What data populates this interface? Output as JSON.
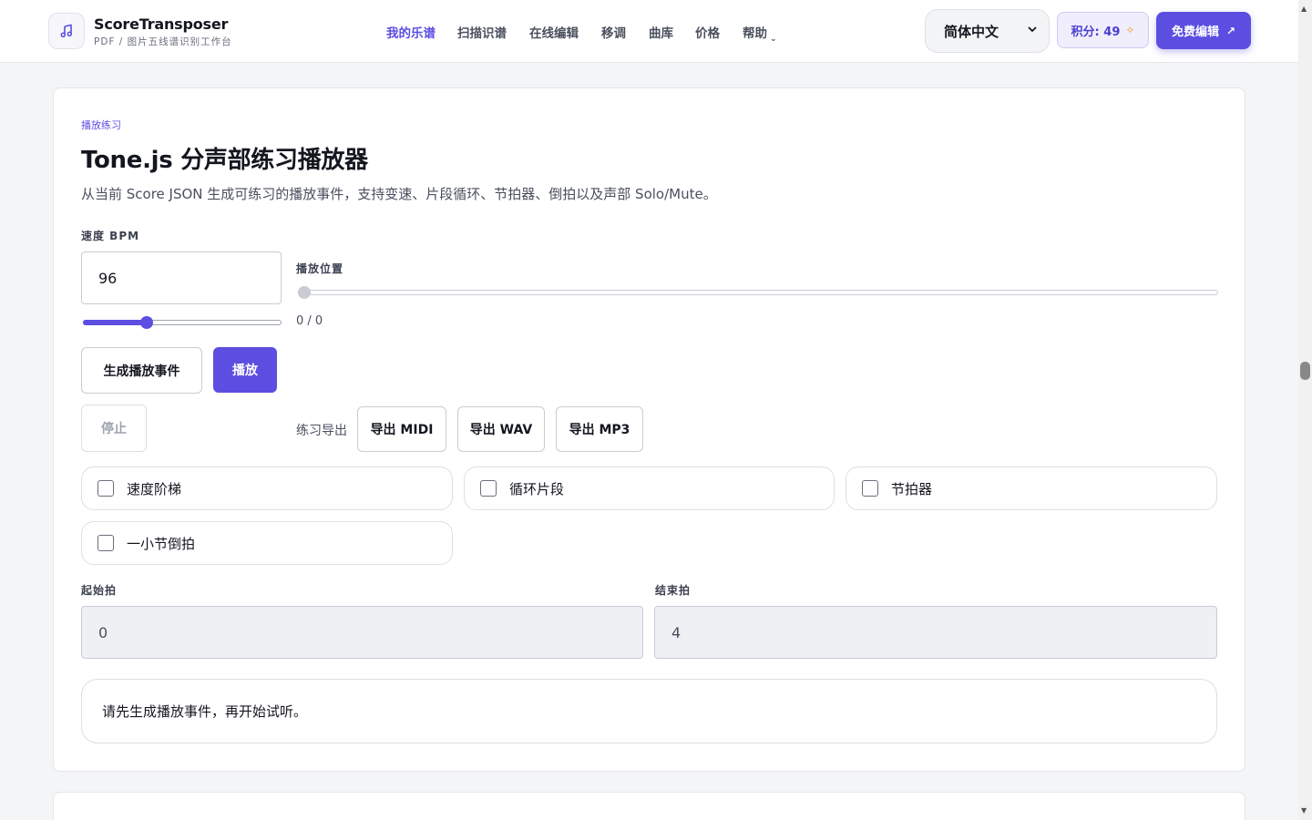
{
  "brand": {
    "name": "ScoreTransposer",
    "subtitle": "PDF / 图片五线谱识别工作台",
    "logo_icon": "music-note-icon"
  },
  "nav": {
    "items": [
      "我的乐谱",
      "扫描识谱",
      "在线编辑",
      "移调",
      "曲库",
      "价格",
      "帮助"
    ],
    "active": "我的乐谱",
    "help_caret": "⌄"
  },
  "header_right": {
    "language": "简体中文",
    "points_label": "积分: 49",
    "points_icon": "✧",
    "cta_label": "免费编辑",
    "cta_icon": "↗"
  },
  "player": {
    "eyebrow": "播放练习",
    "title": "Tone.js 分声部练习播放器",
    "description": "从当前 Score JSON 生成可练习的播放事件，支持变速、片段循环、节拍器、倒拍以及声部 Solo/Mute。",
    "bpm_label": "速度 BPM",
    "bpm_value": "96",
    "bpm_slider_fraction": 0.32,
    "position_label": "播放位置",
    "position_readout": "0 / 0",
    "position_fraction": 0,
    "buttons": {
      "generate": "生成播放事件",
      "play": "播放",
      "stop": "停止"
    },
    "export_label": "练习导出",
    "exports": [
      "导出 MIDI",
      "导出 WAV",
      "导出 MP3"
    ],
    "options": [
      "速度阶梯",
      "循环片段",
      "节拍器",
      "一小节倒拍"
    ],
    "start_beat_label": "起始拍",
    "start_beat_value": "0",
    "end_beat_label": "结束拍",
    "end_beat_value": "4",
    "status_message": "请先生成播放事件，再开始试听。"
  },
  "colors": {
    "accent": "#5b4ee0",
    "accent_light": "#f0eefc",
    "spark": "#f59a23"
  }
}
